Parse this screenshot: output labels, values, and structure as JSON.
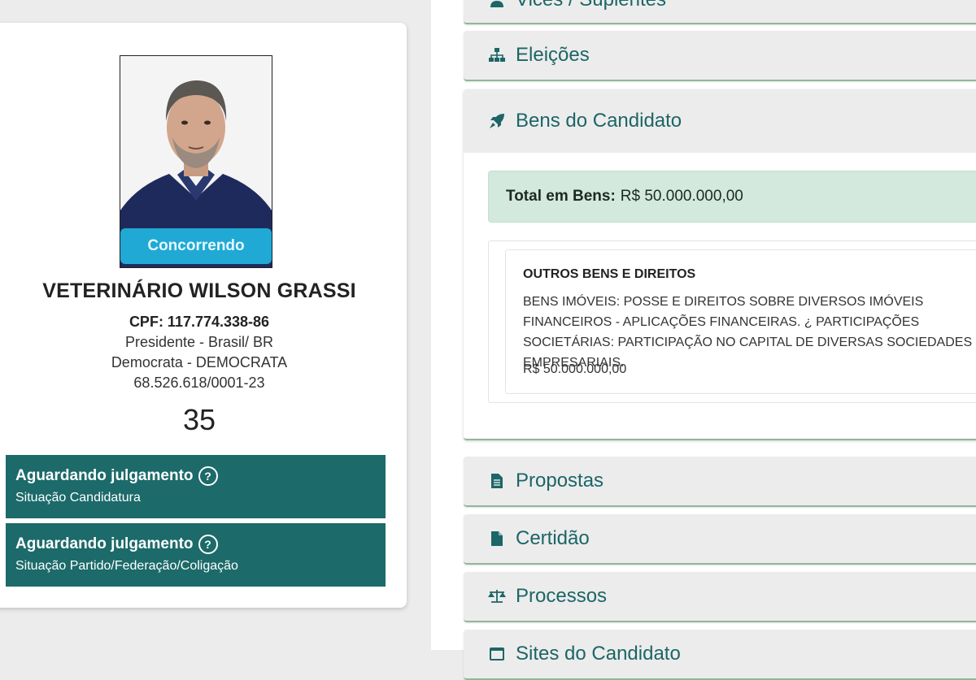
{
  "candidate": {
    "badge": "Concorrendo",
    "name": "VETERINÁRIO WILSON GRASSI",
    "cpf_line": "CPF: 117.774.338-86",
    "office_line": "Presidente - Brasil/ BR",
    "party_line": "Democrata - DEMOCRATA",
    "cnpj_line": "68.526.618/0001-23",
    "number": "35"
  },
  "status": [
    {
      "title": "Aguardando julgamento",
      "subtitle": "Situação Candidatura"
    },
    {
      "title": "Aguardando julgamento",
      "subtitle": "Situação Partido/Federação/Coligação"
    }
  ],
  "help_symbol": "?",
  "sections": {
    "vices": {
      "label": "Vices / Suplentes",
      "icon": "user-icon"
    },
    "eleicoes": {
      "label": "Eleições",
      "icon": "sitemap-icon"
    },
    "bens": {
      "label": "Bens do Candidato",
      "icon": "rocket-icon"
    },
    "propostas": {
      "label": "Propostas",
      "icon": "file-text-icon"
    },
    "certidao": {
      "label": "Certidão",
      "icon": "file-icon"
    },
    "processos": {
      "label": "Processos",
      "icon": "balance-scale-icon"
    },
    "sites": {
      "label": "Sites do Candidato",
      "icon": "window-icon"
    }
  },
  "bens": {
    "total_label": "Total em Bens:",
    "total_value": "R$ 50.000.000,00",
    "items": [
      {
        "title": "OUTROS BENS E DIREITOS",
        "description": "BENS IMÓVEIS: POSSE E DIREITOS SOBRE DIVERSOS IMÓVEIS FINANCEIROS - APLICAÇÕES FINANCEIRAS. ¿ PARTICIPAÇÕES SOCIETÁRIAS: PARTICIPAÇÃO NO CAPITAL DE DIVERSAS SOCIEDADES EMPRESARIAIS.",
        "value": "R$ 50.000.000,00"
      }
    ]
  },
  "colors": {
    "accent_teal": "#1d6566",
    "status_bg": "#1c6a6a",
    "badge_blue": "#1fa9d4",
    "total_bg": "#d3e9dd"
  }
}
